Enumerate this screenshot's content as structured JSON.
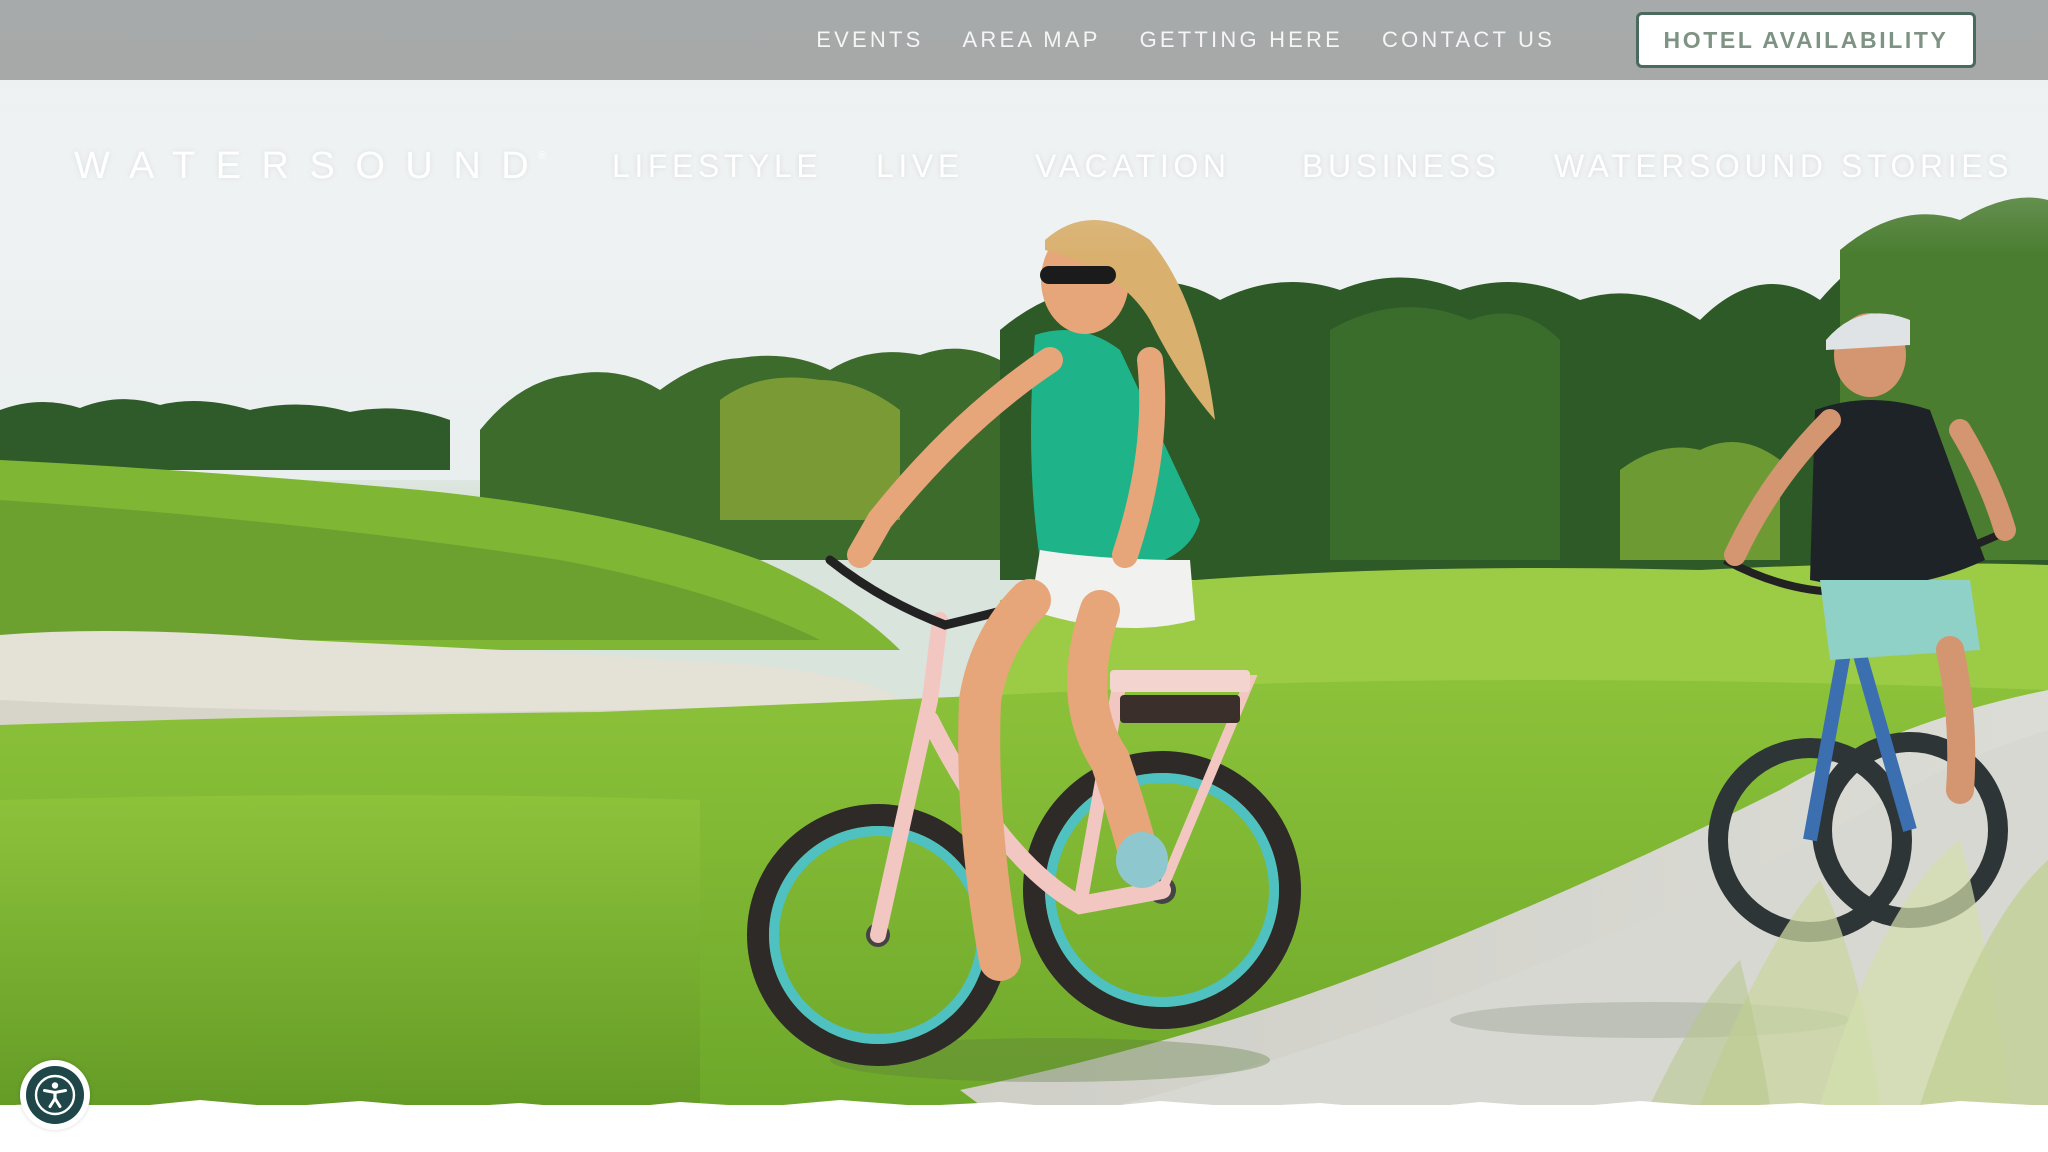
{
  "utility_nav": {
    "links": [
      "EVENTS",
      "AREA MAP",
      "GETTING HERE",
      "CONTACT US"
    ],
    "cta_label": "HOTEL AVAILABILITY"
  },
  "brand": {
    "logo_text": "WATERSOUND",
    "registered_mark": "®"
  },
  "main_nav": {
    "items": [
      "LIFESTYLE",
      "LIVE",
      "VACATION",
      "BUSINESS",
      "WATERSOUND STORIES"
    ]
  },
  "hero": {
    "image_subject": "two people riding electric bicycles on a path beside a golf course"
  },
  "accessibility": {
    "icon": "accessibility-icon"
  },
  "colors": {
    "utility_bar": "#979898",
    "cta_border": "#4a6a5e",
    "cta_text": "#7e9383",
    "accessibility_bg": "#1f4649",
    "nav_text": "#ffffff"
  }
}
